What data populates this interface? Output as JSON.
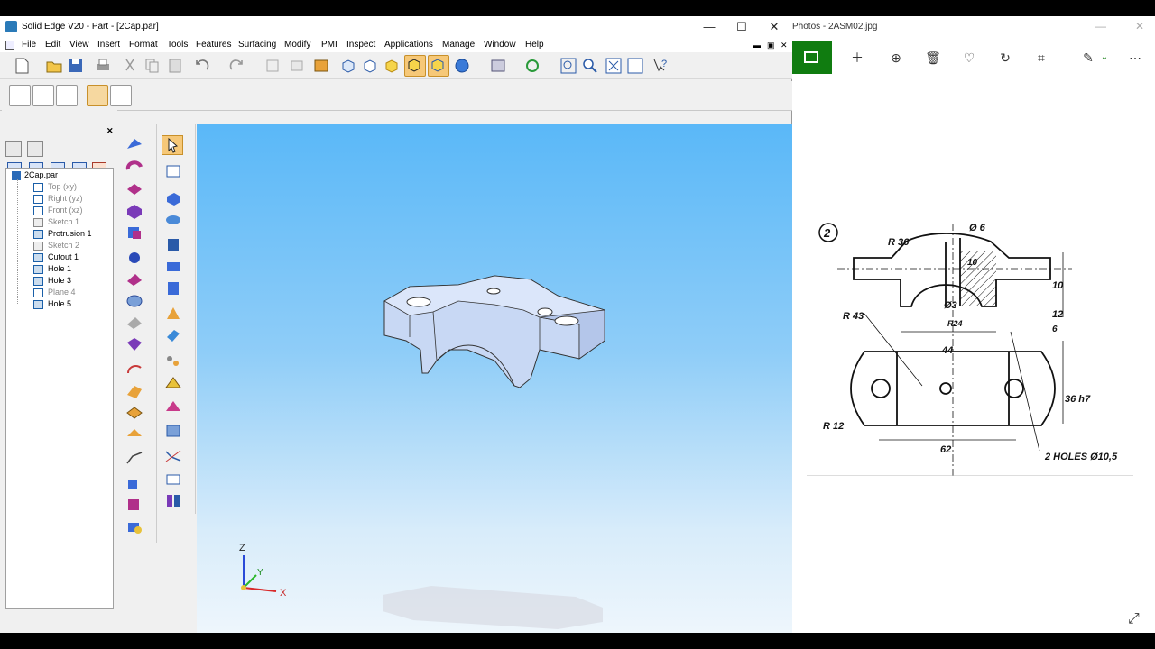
{
  "solidedge": {
    "title": "Solid Edge V20 - Part - [2Cap.par]",
    "window_controls": {
      "minimize": "—",
      "maximize": "☐",
      "close": "✕"
    },
    "menu": [
      "File",
      "Edit",
      "View",
      "Insert",
      "Format",
      "Tools",
      "Features",
      "Surfacing",
      "Modify",
      "PMI",
      "Inspect",
      "Applications",
      "Manage",
      "Window",
      "Help"
    ],
    "tree": {
      "root": "2Cap.par",
      "items": [
        {
          "label": "Top (xy)",
          "dim": true
        },
        {
          "label": "Right (yz)",
          "dim": true
        },
        {
          "label": "Front (xz)",
          "dim": true
        },
        {
          "label": "Sketch 1",
          "dim": true
        },
        {
          "label": "Protrusion 1",
          "dim": false
        },
        {
          "label": "Sketch 2",
          "dim": true
        },
        {
          "label": "Cutout 1",
          "dim": false
        },
        {
          "label": "Hole 1",
          "dim": false
        },
        {
          "label": "Hole 3",
          "dim": false
        },
        {
          "label": "Plane 4",
          "dim": true
        },
        {
          "label": "Hole 5",
          "dim": false
        }
      ]
    },
    "triad": {
      "z": "Z",
      "y": "Y",
      "x": "X"
    }
  },
  "photos": {
    "title": "Photos - 2ASM02.jpg",
    "drawing": {
      "number": "2",
      "labels": {
        "r36": "R 36",
        "d6": "Ø 6",
        "ten_a": "10",
        "ten_b": "10",
        "twelve": "12",
        "six": "6",
        "d3": "Ø3",
        "r24": "R24",
        "r43": "R 43",
        "forty_four": "44",
        "r12": "R 12",
        "thirty_six": "36 h7",
        "sixty_two": "62",
        "holes": "2 HOLES  Ø10,5"
      }
    }
  },
  "colors": {
    "viewport_top": "#5ab8f8",
    "photos_accent": "#107c10",
    "part_face": "#c8d8f4"
  }
}
